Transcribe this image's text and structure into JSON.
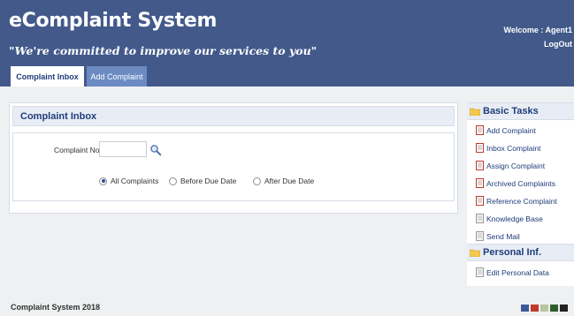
{
  "header": {
    "title": "eComplaint System",
    "tagline": "\"We're committed to improve our services to you\"",
    "welcome": "Welcome : Agent1",
    "logout": "LogOut"
  },
  "tabs": [
    {
      "label": "Complaint Inbox",
      "active": true
    },
    {
      "label": "Add Complaint",
      "active": false
    }
  ],
  "main": {
    "panel_title": "Complaint Inbox",
    "complaint_no_label": "Complaint No. :",
    "complaint_no_value": "",
    "radios": [
      {
        "label": "All Complaints",
        "checked": true
      },
      {
        "label": "Before Due Date",
        "checked": false
      },
      {
        "label": "After Due Date",
        "checked": false
      }
    ]
  },
  "sidebar": {
    "basic_tasks_title": "Basic Tasks",
    "basic_tasks": [
      {
        "label": "Add Complaint",
        "icon": "red-document-icon"
      },
      {
        "label": "Inbox Complaint",
        "icon": "red-document-icon"
      },
      {
        "label": "Assign Complaint",
        "icon": "red-document-icon"
      },
      {
        "label": "Archived Complaints",
        "icon": "red-document-icon"
      },
      {
        "label": "Reference Complaint",
        "icon": "red-document-icon"
      },
      {
        "label": "Knowledge Base",
        "icon": "gray-document-icon"
      },
      {
        "label": "Send Mail",
        "icon": "gray-document-icon"
      }
    ],
    "personal_title": "Personal Inf.",
    "personal_items": [
      {
        "label": "Edit Personal Data",
        "icon": "gray-document-icon"
      }
    ]
  },
  "footer": {
    "text": "Complaint System 2018",
    "swatches": [
      "#3b5998",
      "#c0392b",
      "#b8c5a0",
      "#2e5e2e",
      "#222222"
    ]
  },
  "colors": {
    "header_bg": "#42598a",
    "tab_inactive_bg": "#6b8bc2",
    "accent_text": "#1f3c7a"
  }
}
